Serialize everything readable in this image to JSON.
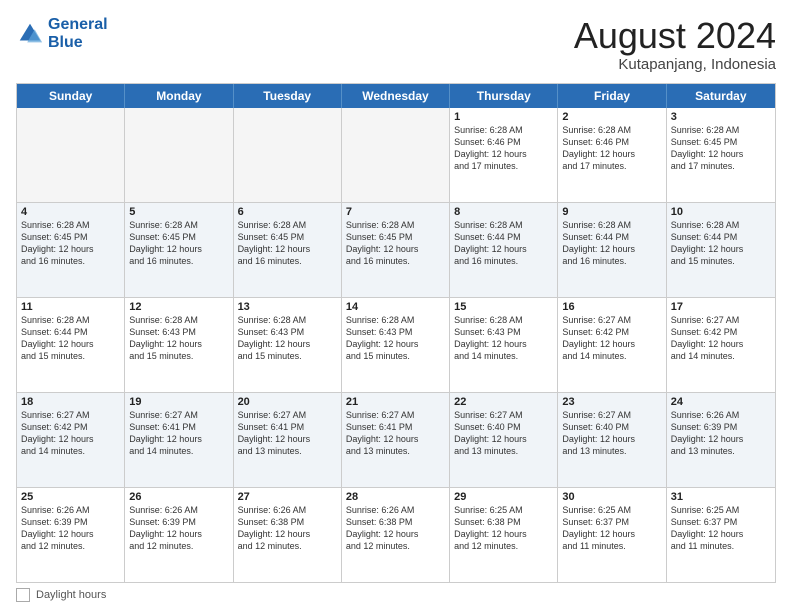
{
  "logo": {
    "line1": "General",
    "line2": "Blue"
  },
  "title": "August 2024",
  "subtitle": "Kutapanjang, Indonesia",
  "weekdays": [
    "Sunday",
    "Monday",
    "Tuesday",
    "Wednesday",
    "Thursday",
    "Friday",
    "Saturday"
  ],
  "footer": {
    "swatch_label": "Daylight hours"
  },
  "weeks": [
    [
      {
        "day": "",
        "info": "",
        "empty": true
      },
      {
        "day": "",
        "info": "",
        "empty": true
      },
      {
        "day": "",
        "info": "",
        "empty": true
      },
      {
        "day": "",
        "info": "",
        "empty": true
      },
      {
        "day": "1",
        "info": "Sunrise: 6:28 AM\nSunset: 6:46 PM\nDaylight: 12 hours\nand 17 minutes."
      },
      {
        "day": "2",
        "info": "Sunrise: 6:28 AM\nSunset: 6:46 PM\nDaylight: 12 hours\nand 17 minutes."
      },
      {
        "day": "3",
        "info": "Sunrise: 6:28 AM\nSunset: 6:45 PM\nDaylight: 12 hours\nand 17 minutes."
      }
    ],
    [
      {
        "day": "4",
        "info": "Sunrise: 6:28 AM\nSunset: 6:45 PM\nDaylight: 12 hours\nand 16 minutes."
      },
      {
        "day": "5",
        "info": "Sunrise: 6:28 AM\nSunset: 6:45 PM\nDaylight: 12 hours\nand 16 minutes."
      },
      {
        "day": "6",
        "info": "Sunrise: 6:28 AM\nSunset: 6:45 PM\nDaylight: 12 hours\nand 16 minutes."
      },
      {
        "day": "7",
        "info": "Sunrise: 6:28 AM\nSunset: 6:45 PM\nDaylight: 12 hours\nand 16 minutes."
      },
      {
        "day": "8",
        "info": "Sunrise: 6:28 AM\nSunset: 6:44 PM\nDaylight: 12 hours\nand 16 minutes."
      },
      {
        "day": "9",
        "info": "Sunrise: 6:28 AM\nSunset: 6:44 PM\nDaylight: 12 hours\nand 16 minutes."
      },
      {
        "day": "10",
        "info": "Sunrise: 6:28 AM\nSunset: 6:44 PM\nDaylight: 12 hours\nand 15 minutes."
      }
    ],
    [
      {
        "day": "11",
        "info": "Sunrise: 6:28 AM\nSunset: 6:44 PM\nDaylight: 12 hours\nand 15 minutes."
      },
      {
        "day": "12",
        "info": "Sunrise: 6:28 AM\nSunset: 6:43 PM\nDaylight: 12 hours\nand 15 minutes."
      },
      {
        "day": "13",
        "info": "Sunrise: 6:28 AM\nSunset: 6:43 PM\nDaylight: 12 hours\nand 15 minutes."
      },
      {
        "day": "14",
        "info": "Sunrise: 6:28 AM\nSunset: 6:43 PM\nDaylight: 12 hours\nand 15 minutes."
      },
      {
        "day": "15",
        "info": "Sunrise: 6:28 AM\nSunset: 6:43 PM\nDaylight: 12 hours\nand 14 minutes."
      },
      {
        "day": "16",
        "info": "Sunrise: 6:27 AM\nSunset: 6:42 PM\nDaylight: 12 hours\nand 14 minutes."
      },
      {
        "day": "17",
        "info": "Sunrise: 6:27 AM\nSunset: 6:42 PM\nDaylight: 12 hours\nand 14 minutes."
      }
    ],
    [
      {
        "day": "18",
        "info": "Sunrise: 6:27 AM\nSunset: 6:42 PM\nDaylight: 12 hours\nand 14 minutes."
      },
      {
        "day": "19",
        "info": "Sunrise: 6:27 AM\nSunset: 6:41 PM\nDaylight: 12 hours\nand 14 minutes."
      },
      {
        "day": "20",
        "info": "Sunrise: 6:27 AM\nSunset: 6:41 PM\nDaylight: 12 hours\nand 13 minutes."
      },
      {
        "day": "21",
        "info": "Sunrise: 6:27 AM\nSunset: 6:41 PM\nDaylight: 12 hours\nand 13 minutes."
      },
      {
        "day": "22",
        "info": "Sunrise: 6:27 AM\nSunset: 6:40 PM\nDaylight: 12 hours\nand 13 minutes."
      },
      {
        "day": "23",
        "info": "Sunrise: 6:27 AM\nSunset: 6:40 PM\nDaylight: 12 hours\nand 13 minutes."
      },
      {
        "day": "24",
        "info": "Sunrise: 6:26 AM\nSunset: 6:39 PM\nDaylight: 12 hours\nand 13 minutes."
      }
    ],
    [
      {
        "day": "25",
        "info": "Sunrise: 6:26 AM\nSunset: 6:39 PM\nDaylight: 12 hours\nand 12 minutes."
      },
      {
        "day": "26",
        "info": "Sunrise: 6:26 AM\nSunset: 6:39 PM\nDaylight: 12 hours\nand 12 minutes."
      },
      {
        "day": "27",
        "info": "Sunrise: 6:26 AM\nSunset: 6:38 PM\nDaylight: 12 hours\nand 12 minutes."
      },
      {
        "day": "28",
        "info": "Sunrise: 6:26 AM\nSunset: 6:38 PM\nDaylight: 12 hours\nand 12 minutes."
      },
      {
        "day": "29",
        "info": "Sunrise: 6:25 AM\nSunset: 6:38 PM\nDaylight: 12 hours\nand 12 minutes."
      },
      {
        "day": "30",
        "info": "Sunrise: 6:25 AM\nSunset: 6:37 PM\nDaylight: 12 hours\nand 11 minutes."
      },
      {
        "day": "31",
        "info": "Sunrise: 6:25 AM\nSunset: 6:37 PM\nDaylight: 12 hours\nand 11 minutes."
      }
    ]
  ]
}
